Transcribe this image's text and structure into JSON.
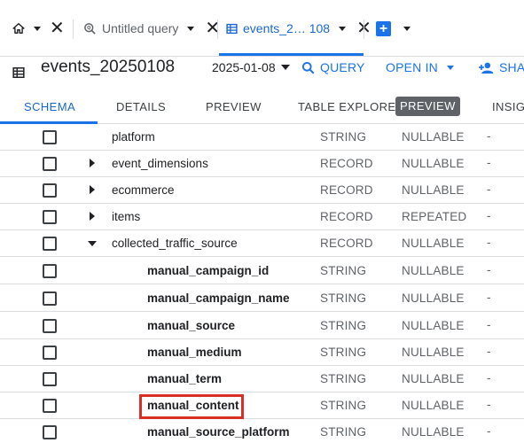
{
  "tabs": {
    "untitled_label": "Untitled query",
    "events_label": "events_2… 108"
  },
  "header": {
    "title": "events_20250108",
    "date": "2025-01-08",
    "query_label": "QUERY",
    "open_in_label": "OPEN IN",
    "share_label": "SHAR"
  },
  "subtabs": {
    "schema": "SCHEMA",
    "details": "DETAILS",
    "preview": "PREVIEW",
    "table_explorer": "TABLE EXPLORER",
    "preview_badge": "PREVIEW",
    "insights": "INSIGH"
  },
  "colors": {
    "accent": "#1a73e8",
    "highlight": "#d93025"
  },
  "schema": {
    "rows": [
      {
        "name": "platform",
        "type": "STRING",
        "mode": "NULLABLE",
        "desc": "-"
      },
      {
        "name": "event_dimensions",
        "type": "RECORD",
        "mode": "NULLABLE",
        "desc": "-"
      },
      {
        "name": "ecommerce",
        "type": "RECORD",
        "mode": "NULLABLE",
        "desc": "-"
      },
      {
        "name": "items",
        "type": "RECORD",
        "mode": "REPEATED",
        "desc": "-"
      },
      {
        "name": "collected_traffic_source",
        "type": "RECORD",
        "mode": "NULLABLE",
        "desc": "-"
      },
      {
        "name": "manual_campaign_id",
        "type": "STRING",
        "mode": "NULLABLE",
        "desc": "-"
      },
      {
        "name": "manual_campaign_name",
        "type": "STRING",
        "mode": "NULLABLE",
        "desc": "-"
      },
      {
        "name": "manual_source",
        "type": "STRING",
        "mode": "NULLABLE",
        "desc": "-"
      },
      {
        "name": "manual_medium",
        "type": "STRING",
        "mode": "NULLABLE",
        "desc": "-"
      },
      {
        "name": "manual_term",
        "type": "STRING",
        "mode": "NULLABLE",
        "desc": "-"
      },
      {
        "name": "manual_content",
        "type": "STRING",
        "mode": "NULLABLE",
        "desc": "-"
      },
      {
        "name": "manual_source_platform",
        "type": "STRING",
        "mode": "NULLABLE",
        "desc": "-"
      }
    ]
  }
}
